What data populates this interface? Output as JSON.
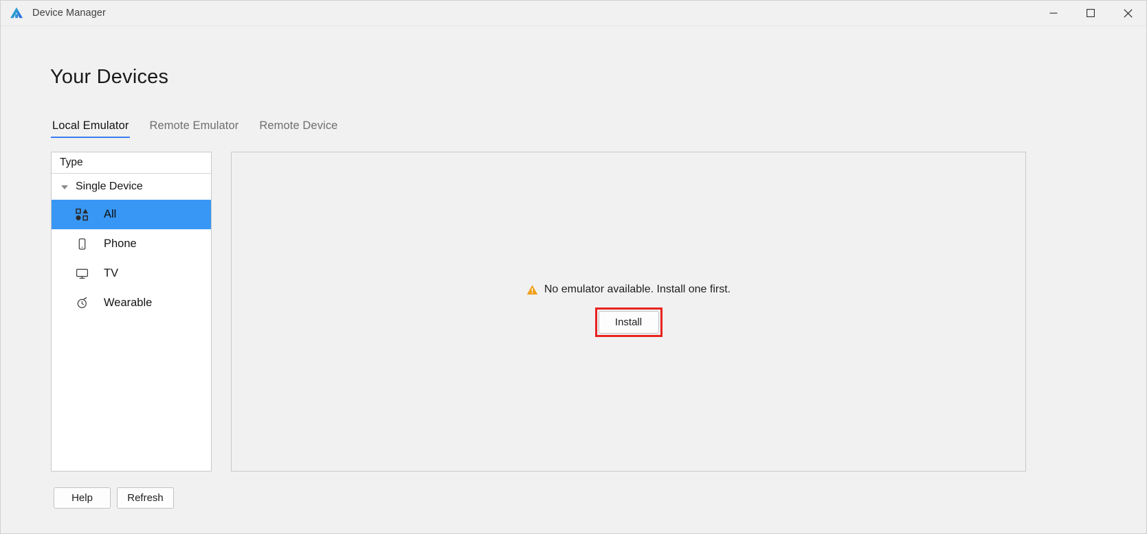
{
  "titlebar": {
    "app_title": "Device Manager",
    "logo_icon": "deveco-logo-icon",
    "logo_color_start": "#2ec4c9",
    "logo_color_end": "#2f6fe0",
    "minimize_label": "minimize-icon",
    "maximize_label": "maximize-icon",
    "close_label": "close-icon"
  },
  "page": {
    "title": "Your Devices"
  },
  "tabs": [
    {
      "label": "Local Emulator",
      "active": true
    },
    {
      "label": "Remote Emulator",
      "active": false
    },
    {
      "label": "Remote Device",
      "active": false
    }
  ],
  "sidebar": {
    "header": "Type",
    "group": {
      "label": "Single Device",
      "expanded": true,
      "caret_icon": "caret-down-icon"
    },
    "items": [
      {
        "label": "All",
        "icon": "shapes-grid-icon",
        "selected": true
      },
      {
        "label": "Phone",
        "icon": "phone-icon",
        "selected": false
      },
      {
        "label": "TV",
        "icon": "tv-icon",
        "selected": false
      },
      {
        "label": "Wearable",
        "icon": "watch-icon",
        "selected": false
      }
    ],
    "selected_color": "#3897f5"
  },
  "detail": {
    "empty_message": "No emulator available. Install one first.",
    "warning_icon": "warning-triangle-icon",
    "warning_color": "#f0a018",
    "install_label": "Install",
    "highlight_color": "#e8231f"
  },
  "footer": {
    "help_label": "Help",
    "refresh_label": "Refresh"
  }
}
